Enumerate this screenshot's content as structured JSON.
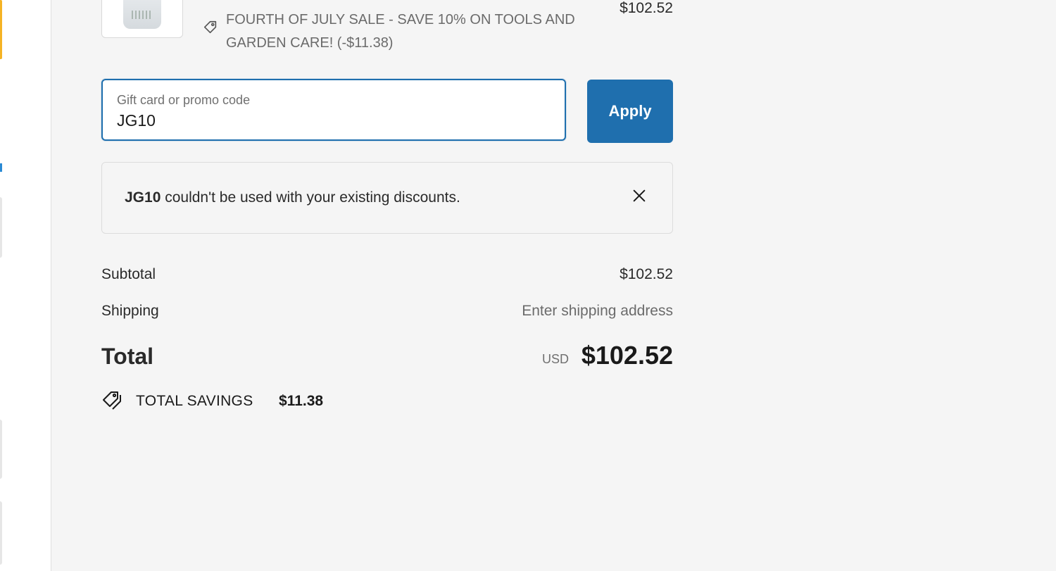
{
  "order_line": {
    "discount_text": "FOURTH OF JULY SALE - SAVE 10% ON TOOLS AND GARDEN CARE! (-$11.38)",
    "price": "$102.52"
  },
  "promo": {
    "label": "Gift card or promo code",
    "value": "JG10",
    "apply_label": "Apply"
  },
  "notice": {
    "code": "JG10",
    "message": " couldn't be used with your existing discounts."
  },
  "totals": {
    "subtotal_label": "Subtotal",
    "subtotal_value": "$102.52",
    "shipping_label": "Shipping",
    "shipping_value": "Enter shipping address",
    "total_label": "Total",
    "currency": "USD",
    "total_value": "$102.52"
  },
  "savings": {
    "label": "TOTAL SAVINGS",
    "value": "$11.38"
  },
  "icons": {
    "tag": "tag-icon",
    "close": "close-icon",
    "savings": "savings-tag-icon"
  },
  "colors": {
    "accent": "#1f6fae",
    "background": "#f5f5f5",
    "muted_text": "#6b6b6b"
  }
}
